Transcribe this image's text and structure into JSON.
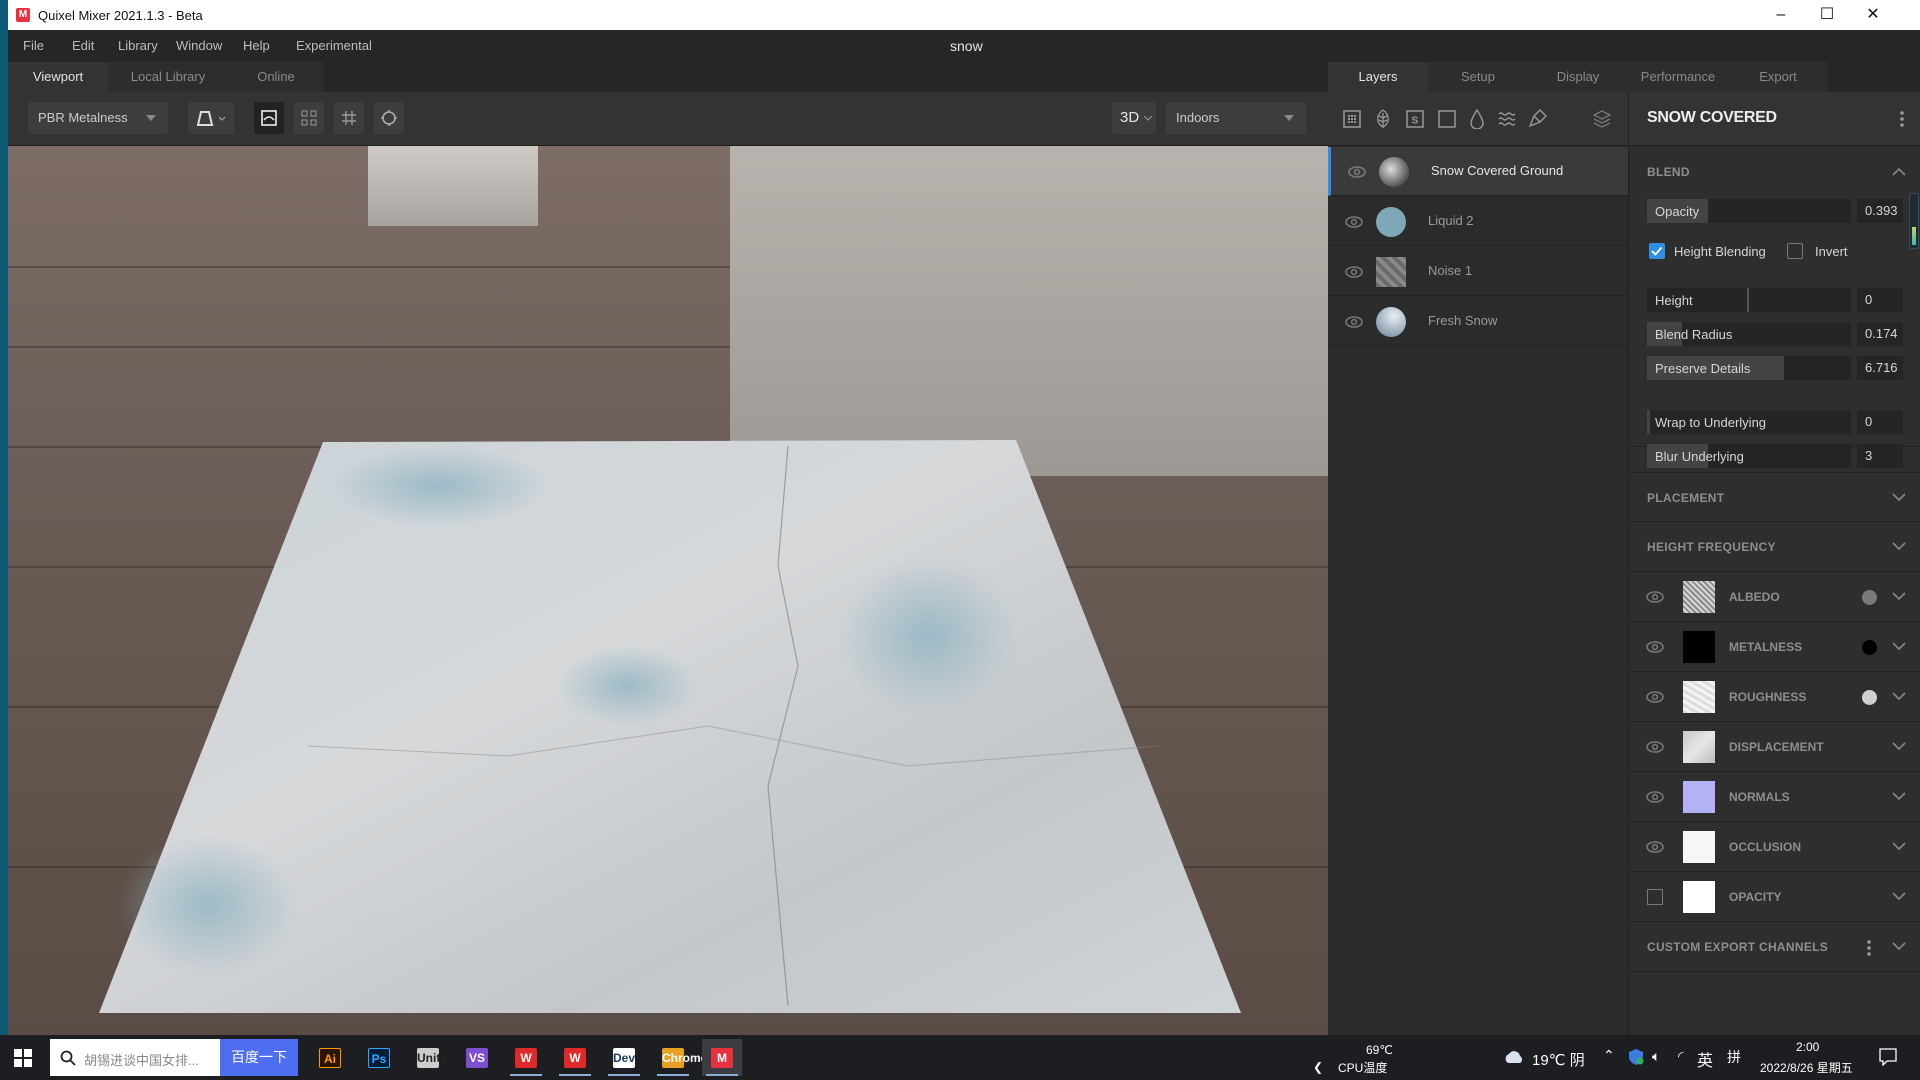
{
  "window": {
    "app_title": "Quixel Mixer 2021.1.3 - Beta",
    "app_icon": "M",
    "minimize": "–",
    "maximize": "☐",
    "close": "✕"
  },
  "menu": {
    "items": [
      "File",
      "Edit",
      "Library",
      "Window",
      "Help",
      "Experimental"
    ],
    "document_title": "snow"
  },
  "left_tabs": [
    {
      "label": "Viewport",
      "active": true
    },
    {
      "label": "Local Library",
      "active": false
    },
    {
      "label": "Online",
      "active": false
    }
  ],
  "viewport_toolbar": {
    "workflow_select": "PBR Metalness",
    "view_mode": "3D",
    "environment_select": "Indoors",
    "icons": [
      "mesh-shape-icon",
      "2d-preview-icon",
      "grid-2x2-icon",
      "grid-hash-icon",
      "target-icon"
    ]
  },
  "right_tabs": [
    {
      "label": "Layers",
      "active": true
    },
    {
      "label": "Setup",
      "active": false
    },
    {
      "label": "Display",
      "active": false
    },
    {
      "label": "Performance",
      "active": false
    },
    {
      "label": "Export",
      "active": false
    }
  ],
  "layer_tools": [
    "surface-icon",
    "leaf-icon",
    "smart-material-icon",
    "solid-icon",
    "liquid-icon",
    "noise-icon",
    "brush-icon",
    "layer-stack-icon"
  ],
  "layers": [
    {
      "name": "Snow Covered Ground",
      "active": true,
      "thumb": "surface"
    },
    {
      "name": "Liquid 2",
      "active": false,
      "thumb": "liquid"
    },
    {
      "name": "Noise 1",
      "active": false,
      "thumb": "noise"
    },
    {
      "name": "Fresh Snow",
      "active": false,
      "thumb": "snow"
    }
  ],
  "props": {
    "title": "SNOW COVERED",
    "blend": {
      "header": "BLEND",
      "opacity": {
        "label": "Opacity",
        "value": "0.393",
        "fraction": 0.3
      },
      "height_blending": {
        "label": "Height Blending",
        "checked": true
      },
      "invert": {
        "label": "Invert",
        "checked": false
      },
      "height": {
        "label": "Height",
        "value": "0",
        "fraction": 0.5
      },
      "blend_radius": {
        "label": "Blend Radius",
        "value": "0.174",
        "fraction": 0.17
      },
      "preserve_details": {
        "label": "Preserve Details",
        "value": "6.716",
        "fraction": 0.67
      },
      "wrap_to_underlying": {
        "label": "Wrap to Underlying",
        "value": "0",
        "fraction": 0.0
      },
      "blur_underlying": {
        "label": "Blur Underlying",
        "value": "3",
        "fraction": 0.3
      }
    },
    "placement": "PLACEMENT",
    "height_frequency": "HEIGHT FREQUENCY",
    "channels": [
      {
        "name": "ALBEDO",
        "visible": true,
        "dot": "#7a7a7a"
      },
      {
        "name": "METALNESS",
        "visible": true,
        "dot": "#000000"
      },
      {
        "name": "ROUGHNESS",
        "visible": true,
        "dot": "#d0d0d0"
      },
      {
        "name": "DISPLACEMENT",
        "visible": true,
        "dot": null
      },
      {
        "name": "NORMALS",
        "visible": true,
        "dot": null
      },
      {
        "name": "OCCLUSION",
        "visible": true,
        "dot": null
      },
      {
        "name": "OPACITY",
        "visible": false,
        "dot": null
      }
    ],
    "custom_export": "CUSTOM EXPORT CHANNELS"
  },
  "taskbar": {
    "search_text": "胡锡进谈中国女排...",
    "search_button": "百度一下",
    "apps": [
      "Ai",
      "Ps",
      "Unity",
      "VS",
      "W",
      "W",
      "Dev",
      "Chrome",
      "M"
    ],
    "cpu_temp": "69℃",
    "cpu_label": "CPU温度",
    "weather": "19℃ 阴",
    "ime": "英",
    "ime2": "拼",
    "time": "2:00",
    "date": "2022/8/26 星期五"
  },
  "colors": {
    "accent": "#2f8fe5",
    "app_bg": "#262626",
    "panel_bg": "#2e2e2e",
    "brand": "#e8313f"
  }
}
